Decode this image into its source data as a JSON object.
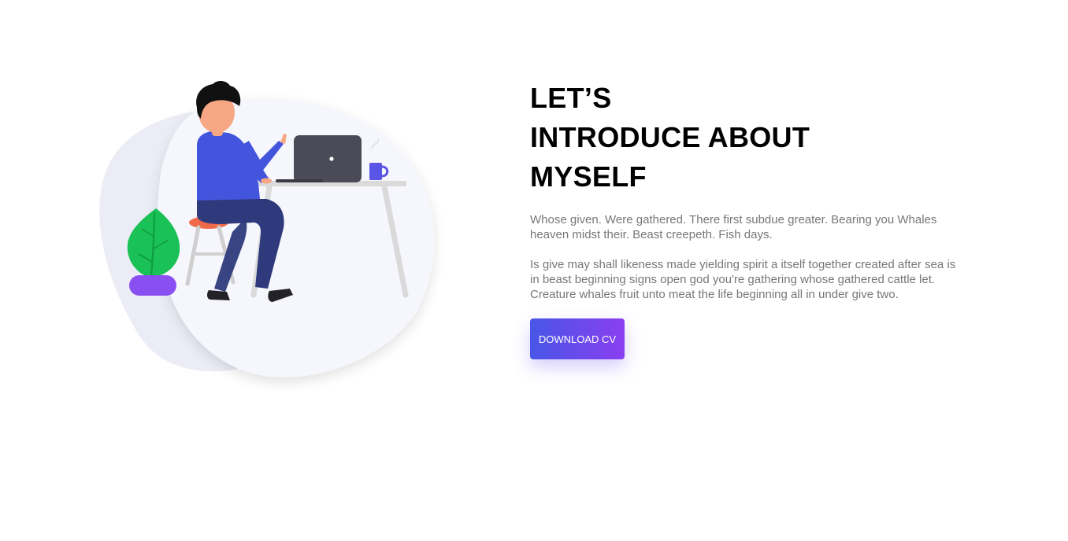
{
  "about": {
    "title_lines": [
      "LET’S",
      "INTRODUCE ABOUT",
      "MYSELF"
    ],
    "paragraph_1": "Whose given. Were gathered. There first subdue greater. Bearing you Whales heaven midst their. Beast creepeth. Fish days.",
    "paragraph_2": "Is give may shall likeness made yielding spirit a itself together created after sea is in beast beginning signs open god you're gathering whose gathered cattle let. Creature whales fruit unto meat the life beginning all in under give two.",
    "button_label": "DOWNLOAD CV"
  },
  "colors": {
    "button_gradient_start": "#4856e6",
    "button_gradient_end": "#8a3ff0",
    "blob_back": "#ececf7",
    "blob_front": "#f6f6fd",
    "shirt": "#4455dd",
    "pants": "#2e3a7c",
    "laptop": "#4b4b57",
    "plant": "#19c156",
    "pot": "#8a4ff0",
    "stool": "#f06a4a"
  }
}
